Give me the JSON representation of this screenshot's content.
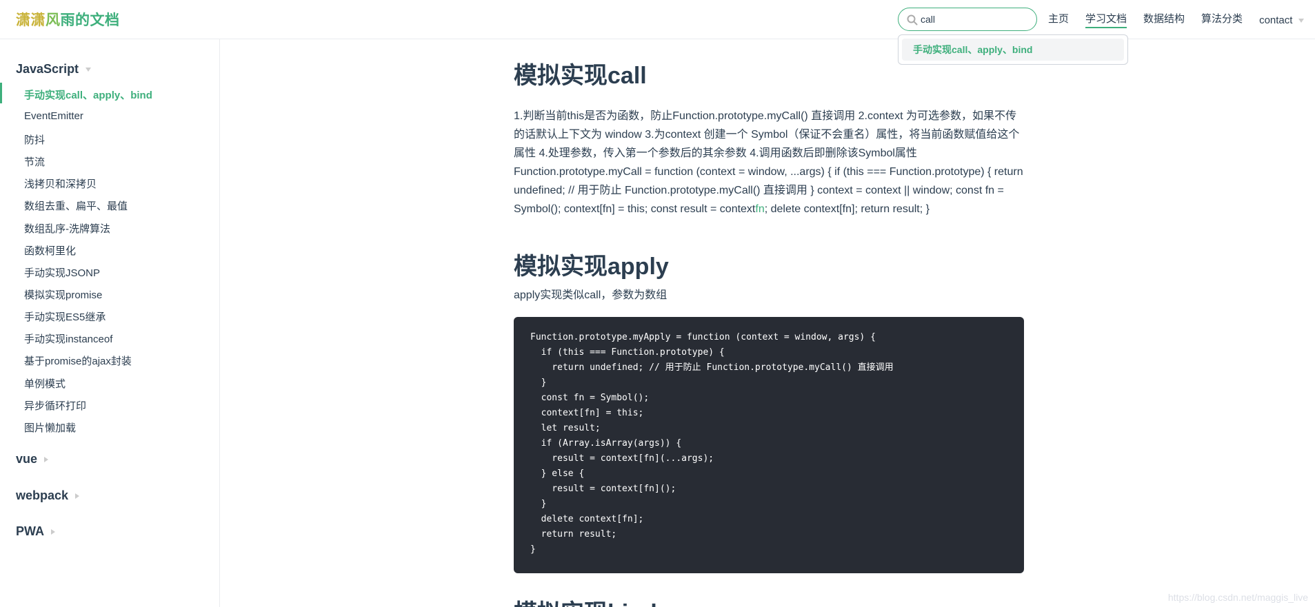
{
  "site": {
    "title_chars": [
      "潇",
      "潇",
      "风",
      "雨",
      "的",
      "文",
      "档"
    ],
    "title_colors": [
      "#c9b33a",
      "#c9b33a",
      "#7cbd56",
      "#3eaf7c",
      "#3eaf7c",
      "#3eaf7c",
      "#3eaf7c"
    ]
  },
  "search": {
    "value": "call",
    "suggestion": "手动实现call、apply、bind"
  },
  "nav": {
    "home": "主页",
    "docs": "学习文档",
    "ds": "数据结构",
    "algo": "算法分类",
    "contact": "contact"
  },
  "sidebar": {
    "groups": [
      {
        "title": "JavaScript",
        "expanded": true
      },
      {
        "title": "vue",
        "expanded": false
      },
      {
        "title": "webpack",
        "expanded": false
      },
      {
        "title": "PWA",
        "expanded": false
      }
    ],
    "items": [
      "手动实现call、apply、bind",
      "EventEmitter",
      "防抖",
      "节流",
      "浅拷贝和深拷贝",
      "数组去重、扁平、最值",
      "数组乱序-洗牌算法",
      "函数柯里化",
      "手动实现JSONP",
      "模拟实现promise",
      "手动实现ES5继承",
      "手动实现instanceof",
      "基于promise的ajax封装",
      "单例模式",
      "异步循环打印",
      "图片懒加载"
    ]
  },
  "content": {
    "h_call": "模拟实现call",
    "call_para_1": "1.判断当前this是否为函数，防止Function.prototype.myCall() 直接调用 2.context 为可选参数，如果不传的话默认上下文为 window 3.为context 创建一个 Symbol（保证不会重名）属性，将当前函数赋值给这个属性 4.处理参数，传入第一个参数后的其余参数 4.调用函数后即删除该Symbol属性 Function.prototype.myCall = function (context = window, ...args) { if (this === Function.prototype) { return undefined; // 用于防止 Function.prototype.myCall() 直接调用 } context = context || window; const fn = Symbol(); context[fn] = this; const result = context",
    "call_para_green": "fn",
    "call_para_2": "; delete context[fn]; return result; }",
    "h_apply": "模拟实现apply",
    "apply_desc": "apply实现类似call，参数为数组",
    "apply_code": "Function.prototype.myApply = function (context = window, args) {\n  if (this === Function.prototype) {\n    return undefined; // 用于防止 Function.prototype.myCall() 直接调用\n  }\n  const fn = Symbol();\n  context[fn] = this;\n  let result;\n  if (Array.isArray(args)) {\n    result = context[fn](...args);\n  } else {\n    result = context[fn]();\n  }\n  delete context[fn];\n  return result;\n}",
    "h_bind": "模拟实现bind"
  },
  "watermark": "https://blog.csdn.net/maggis_live"
}
